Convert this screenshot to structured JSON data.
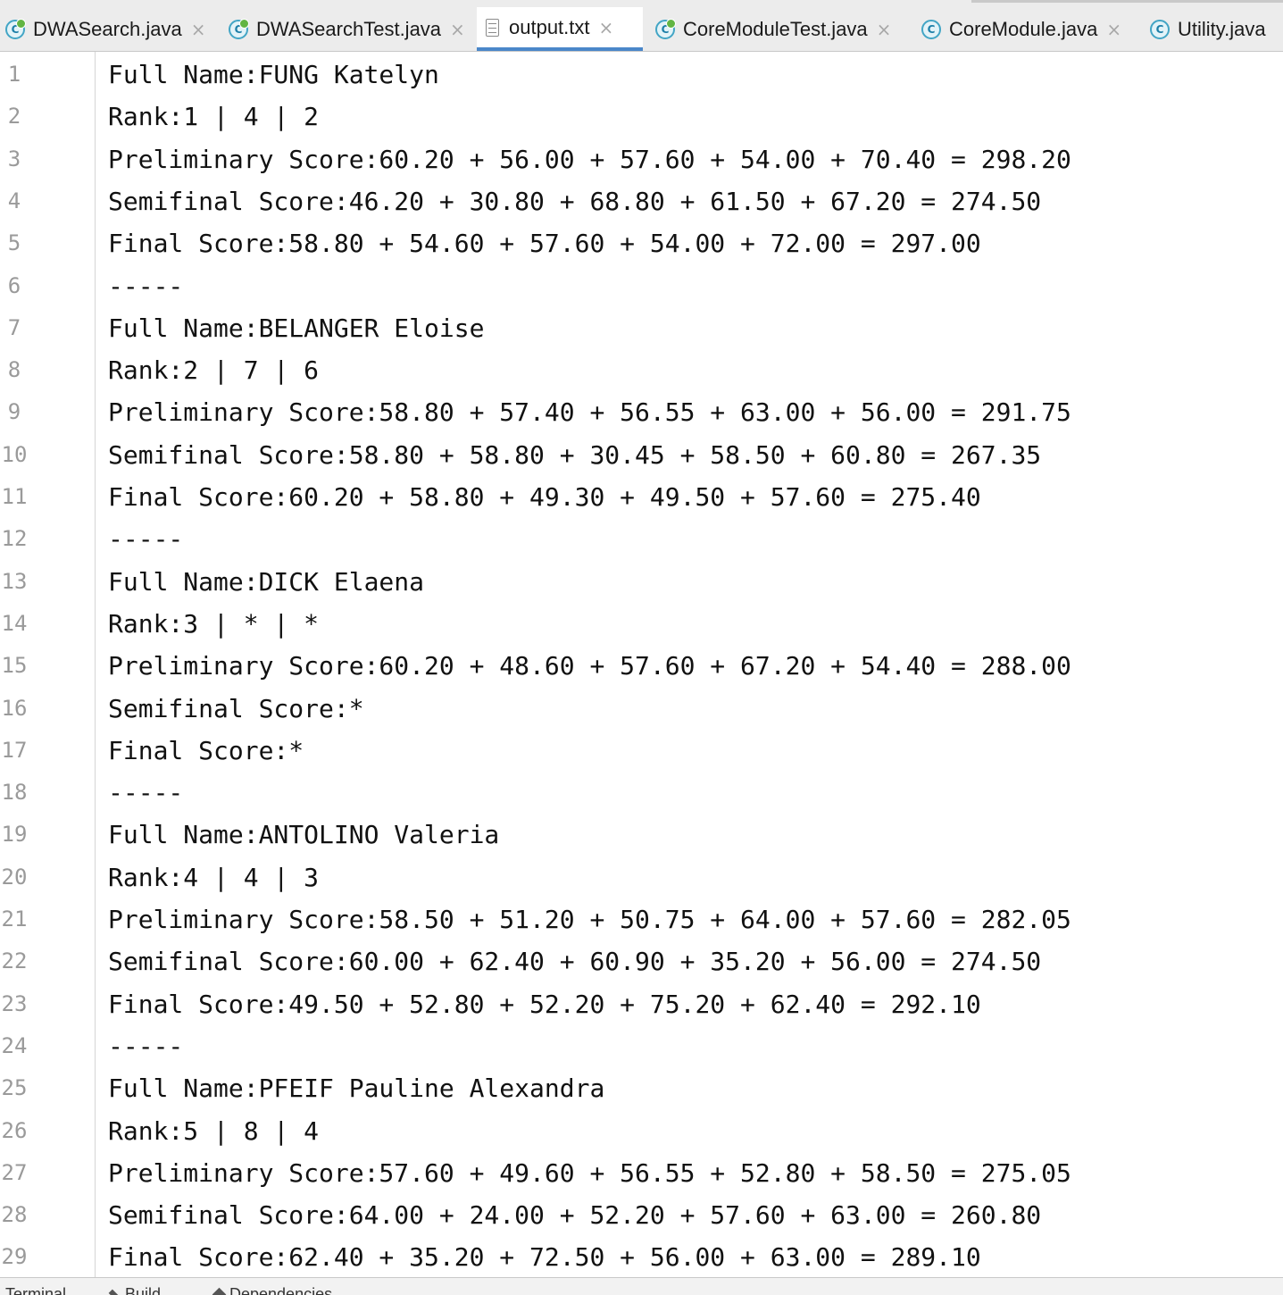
{
  "tabs": [
    {
      "label": "DWASearch.java",
      "icon": "java-class-icon",
      "active": false
    },
    {
      "label": "DWASearchTest.java",
      "icon": "java-class-icon",
      "active": false
    },
    {
      "label": "output.txt",
      "icon": "text-file-icon",
      "active": true
    },
    {
      "label": "CoreModuleTest.java",
      "icon": "java-class-icon",
      "active": false
    },
    {
      "label": "CoreModule.java",
      "icon": "java-class-icon",
      "active": false
    },
    {
      "label": "Utility.java",
      "icon": "java-class-icon",
      "active": false
    }
  ],
  "editor": {
    "lines": [
      {
        "num": "1",
        "text": "Full Name:FUNG Katelyn"
      },
      {
        "num": "2",
        "text": "Rank:1 | 4 | 2"
      },
      {
        "num": "3",
        "text": "Preliminary Score:60.20 + 56.00 + 57.60 + 54.00 + 70.40 = 298.20"
      },
      {
        "num": "4",
        "text": "Semifinal Score:46.20 + 30.80 + 68.80 + 61.50 + 67.20 = 274.50"
      },
      {
        "num": "5",
        "text": "Final Score:58.80 + 54.60 + 57.60 + 54.00 + 72.00 = 297.00"
      },
      {
        "num": "6",
        "text": "-----"
      },
      {
        "num": "7",
        "text": "Full Name:BELANGER Eloise"
      },
      {
        "num": "8",
        "text": "Rank:2 | 7 | 6"
      },
      {
        "num": "9",
        "text": "Preliminary Score:58.80 + 57.40 + 56.55 + 63.00 + 56.00 = 291.75"
      },
      {
        "num": "10",
        "text": "Semifinal Score:58.80 + 58.80 + 30.45 + 58.50 + 60.80 = 267.35"
      },
      {
        "num": "11",
        "text": "Final Score:60.20 + 58.80 + 49.30 + 49.50 + 57.60 = 275.40"
      },
      {
        "num": "12",
        "text": "-----"
      },
      {
        "num": "13",
        "text": "Full Name:DICK Elaena"
      },
      {
        "num": "14",
        "text": "Rank:3 | * | *"
      },
      {
        "num": "15",
        "text": "Preliminary Score:60.20 + 48.60 + 57.60 + 67.20 + 54.40 = 288.00"
      },
      {
        "num": "16",
        "text": "Semifinal Score:*"
      },
      {
        "num": "17",
        "text": "Final Score:*"
      },
      {
        "num": "18",
        "text": "-----"
      },
      {
        "num": "19",
        "text": "Full Name:ANTOLINO Valeria"
      },
      {
        "num": "20",
        "text": "Rank:4 | 4 | 3"
      },
      {
        "num": "21",
        "text": "Preliminary Score:58.50 + 51.20 + 50.75 + 64.00 + 57.60 = 282.05"
      },
      {
        "num": "22",
        "text": "Semifinal Score:60.00 + 62.40 + 60.90 + 35.20 + 56.00 = 274.50"
      },
      {
        "num": "23",
        "text": "Final Score:49.50 + 52.80 + 52.20 + 75.20 + 62.40 = 292.10"
      },
      {
        "num": "24",
        "text": "-----"
      },
      {
        "num": "25",
        "text": "Full Name:PFEIF Pauline Alexandra"
      },
      {
        "num": "26",
        "text": "Rank:5 | 8 | 4"
      },
      {
        "num": "27",
        "text": "Preliminary Score:57.60 + 49.60 + 56.55 + 52.80 + 58.50 = 275.05"
      },
      {
        "num": "28",
        "text": "Semifinal Score:64.00 + 24.00 + 52.20 + 57.60 + 63.00 = 260.80"
      },
      {
        "num": "29",
        "text": "Final Score:62.40 + 35.20 + 72.50 + 56.00 + 63.00 = 289.10"
      }
    ]
  },
  "statusbar": {
    "items": [
      {
        "label": "Terminal",
        "icon": "terminal-icon"
      },
      {
        "label": "Build",
        "icon": "hammer-icon"
      },
      {
        "label": "Dependencies",
        "icon": "dependencies-icon"
      }
    ]
  },
  "colors": {
    "active_tab_underline": "#4a87c9",
    "java_icon": "#42a5c5",
    "line_numbers": "#9a9a9a",
    "text": "#111111"
  }
}
